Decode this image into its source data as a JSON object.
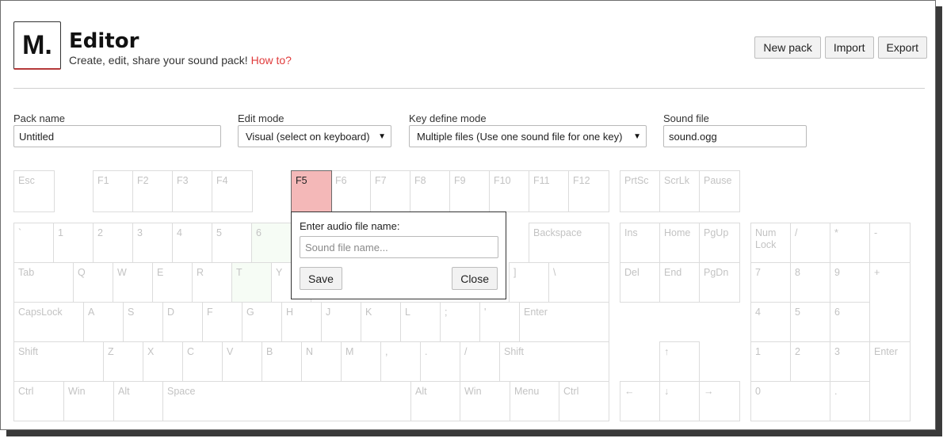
{
  "header": {
    "logo_text": "M.",
    "title": "Editor",
    "subtitle": "Create, edit, share your sound pack!",
    "howto_link": "How to?"
  },
  "toolbar": {
    "new_pack": "New pack",
    "import": "Import",
    "export": "Export"
  },
  "fields": {
    "pack_name": {
      "label": "Pack name",
      "value": "Untitled"
    },
    "edit_mode": {
      "label": "Edit mode",
      "value": "Visual (select on keyboard)"
    },
    "key_define_mode": {
      "label": "Key define mode",
      "value": "Multiple files (Use one sound file for one key)"
    },
    "sound_file": {
      "label": "Sound file",
      "value": "sound.ogg"
    }
  },
  "popup": {
    "label": "Enter audio file name:",
    "placeholder": "Sound file name...",
    "save": "Save",
    "close": "Close"
  },
  "keyboard": {
    "selected_key": "F5",
    "keys": {
      "esc": "Esc",
      "f1": "F1",
      "f2": "F2",
      "f3": "F3",
      "f4": "F4",
      "f5": "F5",
      "f6": "F6",
      "f7": "F7",
      "f8": "F8",
      "f9": "F9",
      "f10": "F10",
      "f11": "F11",
      "f12": "F12",
      "prtsc": "PrtSc",
      "scrlk": "ScrLk",
      "pause": "Pause",
      "backtick": "`",
      "n1": "1",
      "n2": "2",
      "n3": "3",
      "n4": "4",
      "n5": "5",
      "n6": "6",
      "backspace": "Backspace",
      "ins": "Ins",
      "home": "Home",
      "pgup": "PgUp",
      "numlock": "Num Lock",
      "num_div": "/",
      "num_mul": "*",
      "num_sub": "-",
      "tab": "Tab",
      "q": "Q",
      "w": "W",
      "e": "E",
      "r": "R",
      "t": "T",
      "y": "Y",
      "rbracket": "]",
      "backslash": "\\",
      "del": "Del",
      "end": "End",
      "pgdn": "PgDn",
      "num7": "7",
      "num8": "8",
      "num9": "9",
      "num_add": "+",
      "capslock": "CapsLock",
      "a": "A",
      "s": "S",
      "d": "D",
      "f": "F",
      "g": "G",
      "h": "H",
      "j": "J",
      "k": "K",
      "l": "L",
      "semicolon": ";",
      "quote": "'",
      "enter": "Enter",
      "num4": "4",
      "num5": "5",
      "num6": "6",
      "lshift": "Shift",
      "z": "Z",
      "x": "X",
      "c": "C",
      "v": "V",
      "b": "B",
      "n": "N",
      "m": "M",
      "comma": ",",
      "period": ".",
      "slash": "/",
      "rshift": "Shift",
      "up": "↑",
      "num1": "1",
      "num2": "2",
      "num3": "3",
      "num_enter": "Enter",
      "lctrl": "Ctrl",
      "lwin": "Win",
      "lalt": "Alt",
      "space": "Space",
      "ralt": "Alt",
      "rwin": "Win",
      "menu": "Menu",
      "rctrl": "Ctrl",
      "left": "←",
      "down": "↓",
      "right": "→",
      "num0": "0",
      "num_dot": "."
    }
  }
}
